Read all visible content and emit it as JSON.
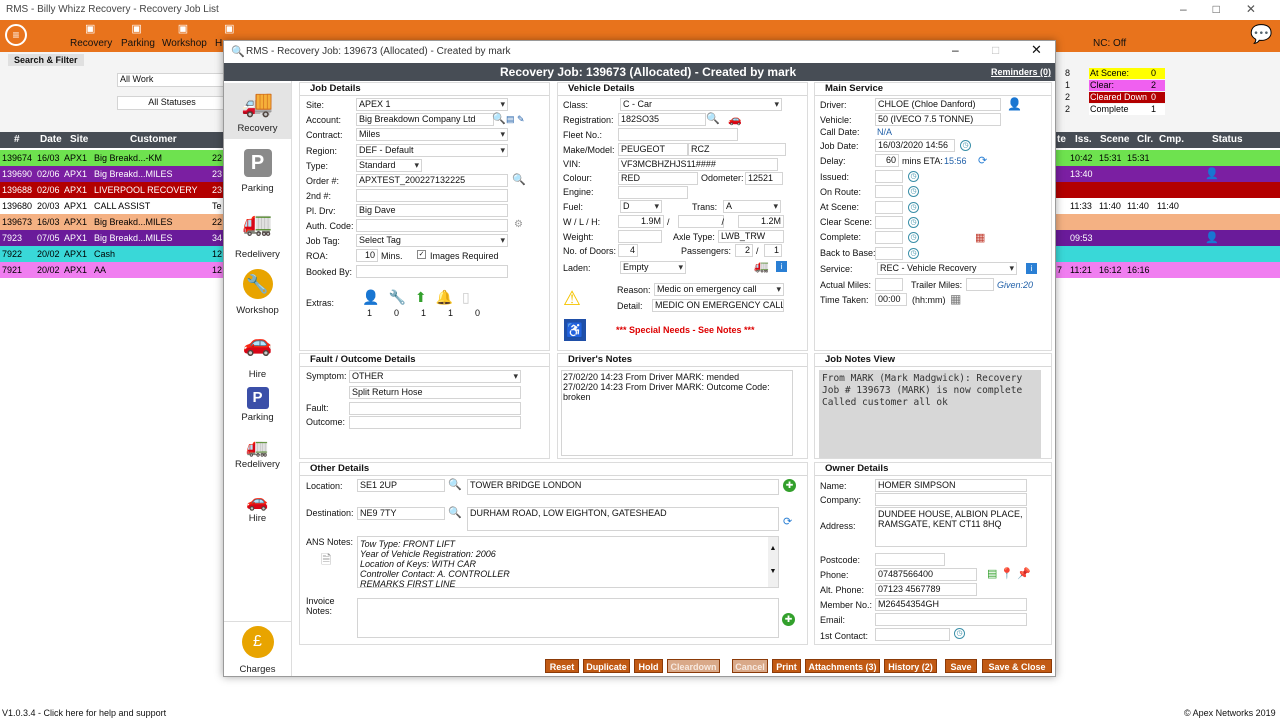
{
  "app": {
    "title": "RMS - Billy Whizz Recovery - Recovery Job List",
    "version": "V1.0.3.4 - Click here for help and support",
    "copyright": "© Apex Networks 2019",
    "nc": "NC: Off"
  },
  "toolbar": [
    "Recovery",
    "Parking",
    "Workshop",
    "H"
  ],
  "filter": {
    "label": "Search & Filter",
    "work": "All Work",
    "statuses": "All Statuses"
  },
  "list": {
    "columns": [
      "#",
      "Date",
      "Site",
      "Customer"
    ],
    "rows": [
      {
        "id": "139674",
        "date": "16/03",
        "site": "APX1",
        "cust": "Big Breakd...-KM",
        "extra": "22",
        "color": "#6ee24f",
        "fg": "#000"
      },
      {
        "id": "139690",
        "date": "02/06",
        "site": "APX1",
        "cust": "Big Breakd...MILES",
        "extra": "23",
        "color": "#7b1fa2",
        "fg": "#fff"
      },
      {
        "id": "139688",
        "date": "02/06",
        "site": "APX1",
        "cust": "LIVERPOOL RECOVERY",
        "extra": "23",
        "color": "#b30000",
        "fg": "#fff"
      },
      {
        "id": "139680",
        "date": "20/03",
        "site": "APX1",
        "cust": "CALL ASSIST",
        "extra": "Te",
        "color": "#ffffff",
        "fg": "#000"
      },
      {
        "id": "139673",
        "date": "16/03",
        "site": "APX1",
        "cust": "Big Breakd...MILES",
        "extra": "22",
        "color": "#f4b183",
        "fg": "#000"
      },
      {
        "id": "7923",
        "date": "07/05",
        "site": "APX1",
        "cust": "Big Breakd...MILES",
        "extra": "34",
        "color": "#6a1b9a",
        "fg": "#fff"
      },
      {
        "id": "7922",
        "date": "20/02",
        "site": "APX1",
        "cust": "Cash",
        "extra": "12",
        "color": "#39d8d8",
        "fg": "#000"
      },
      {
        "id": "7921",
        "date": "20/02",
        "site": "APX1",
        "cust": "AA",
        "extra": "12",
        "color": "#f07ef0",
        "fg": "#000"
      }
    ]
  },
  "right": {
    "legend": [
      {
        "n": "8",
        "label": "At Scene:",
        "v": "0",
        "color": "#ffff00",
        "fg": "#000"
      },
      {
        "n": "1",
        "label": "Clear:",
        "v": "2",
        "color": "#f060f0",
        "fg": "#000"
      },
      {
        "n": "2",
        "label": "Cleared Down",
        "v": "0",
        "color": "#b30000",
        "fg": "#fff"
      },
      {
        "n": "2",
        "label": "Complete",
        "v": "1",
        "color": "#ffffff",
        "fg": "#000"
      }
    ],
    "columns": [
      "te",
      "Iss.",
      "Scene",
      "Clr.",
      "Cmp.",
      "Status"
    ],
    "rows": [
      {
        "c": [
          "",
          "10:42",
          "15:31",
          "15:31",
          ""
        ],
        "color": "#6ee24f",
        "fg": "#000"
      },
      {
        "c": [
          "",
          "13:40",
          "",
          "",
          ""
        ],
        "color": "#7b1fa2",
        "fg": "#fff"
      },
      {
        "c": [
          "",
          "",
          "",
          "",
          ""
        ],
        "color": "#b30000",
        "fg": "#fff"
      },
      {
        "c": [
          "",
          "11:33",
          "11:40",
          "11:40",
          "11:40"
        ],
        "color": "#ffffff",
        "fg": "#000"
      },
      {
        "c": [
          "",
          "",
          "",
          "",
          ""
        ],
        "color": "#f4b183",
        "fg": "#000"
      },
      {
        "c": [
          "",
          "09:53",
          "",
          "",
          ""
        ],
        "color": "#6a1b9a",
        "fg": "#fff"
      },
      {
        "c": [
          "",
          "",
          "",
          "",
          ""
        ],
        "color": "#39d8d8",
        "fg": "#000"
      },
      {
        "c": [
          "7",
          "11:21",
          "16:12",
          "16:16",
          ""
        ],
        "color": "#f07ef0",
        "fg": "#000"
      }
    ]
  },
  "dialog": {
    "window_title": "RMS - Recovery Job: 139673 (Allocated) - Created by mark",
    "banner": "Recovery Job: 139673 (Allocated) - Created by mark",
    "reminders": "Reminders (0)",
    "nav": [
      "Recovery",
      "Parking",
      "Redelivery",
      "Workshop",
      "Hire",
      "Parking",
      "Redelivery",
      "Hire",
      "Charges"
    ]
  },
  "job": {
    "header": "Job Details",
    "site": "APEX 1",
    "account": "Big Breakdown Company Ltd",
    "contract": "Miles",
    "region": "DEF - Default",
    "type": "Standard",
    "order": "APXTEST_200227132225",
    "pl_drv": "Big Dave",
    "job_tag": "Select Tag",
    "roa": "10",
    "roa_unit": "Mins.",
    "images": "Images Required",
    "labels": [
      "Site:",
      "Account:",
      "Contract:",
      "Region:",
      "Type:",
      "Order #:",
      "2nd #:",
      "Pl. Drv:",
      "Auth. Code:",
      "Job Tag:",
      "ROA:",
      "Booked By:",
      "Extras:"
    ],
    "extras": [
      "1",
      "0",
      "1",
      "1",
      "0"
    ]
  },
  "vehicle": {
    "header": "Vehicle Details",
    "class": "C - Car",
    "reg": "182SO35",
    "make": "PEUGEOT",
    "model": "RCZ",
    "vin": "VF3MCBHZHJS11####",
    "colour": "RED",
    "odometer": "12521",
    "fuel": "D",
    "trans": "A",
    "w": "1.9M",
    "h": "1.2M",
    "axle": "LWB_TRW",
    "doors": "4",
    "pass1": "2",
    "pass2": "1",
    "laden": "Empty",
    "reason": "Medic on emergency call",
    "detail": "MEDIC ON EMERGENCY CALL",
    "special": "*** Special Needs - See Notes ***",
    "labels": [
      "Class:",
      "Registration:",
      "Fleet No.:",
      "Make/Model:",
      "VIN:",
      "Colour:",
      "Odometer:",
      "Engine:",
      "Fuel:",
      "Trans:",
      "W / L / H:",
      "Weight:",
      "Axle Type:",
      "No. of Doors:",
      "Passengers:",
      "Laden:",
      "Reason:",
      "Detail:"
    ]
  },
  "service": {
    "header": "Main Service",
    "driver": "CHLOE (Chloe Danford)",
    "vehicle": "50 (IVECO 7.5 TONNE)",
    "call_date": "N/A",
    "job_date": "16/03/2020 14:56",
    "delay": "60",
    "eta_label": "mins ETA:",
    "eta": "15:56",
    "service": "REC - Vehicle Recovery",
    "trailer_label": "Trailer Miles:",
    "given": "Given:20",
    "time_taken": "00:00",
    "time_unit": "(hh:mm)",
    "labels": [
      "Driver:",
      "Vehicle:",
      "Call Date:",
      "Job Date:",
      "Delay:",
      "Issued:",
      "On Route:",
      "At Scene:",
      "Clear Scene:",
      "Complete:",
      "Back to Base:",
      "Service:",
      "Actual Miles:",
      "Time Taken:"
    ]
  },
  "fault": {
    "header": "Fault / Outcome Details",
    "symptom": "OTHER",
    "symptom2": "Split Return Hose",
    "labels": [
      "Symptom:",
      "Fault:",
      "Outcome:"
    ]
  },
  "driver_notes": {
    "header": "Driver's Notes",
    "lines": [
      "27/02/20 14:23 From Driver MARK: mended",
      "27/02/20 14:23 From Driver MARK: Outcome Code:",
      "broken"
    ]
  },
  "job_notes": {
    "header": "Job Notes View",
    "lines": [
      "From MARK (Mark Madgwick): Recovery",
      "Job # 139673 (MARK) is now complete",
      "Called customer all ok"
    ]
  },
  "other": {
    "header": "Other Details",
    "location_pc": "SE1 2UP",
    "location": "TOWER BRIDGE LONDON",
    "dest_pc": "NE9 7TY",
    "destination": "DURHAM ROAD, LOW EIGHTON, GATESHEAD",
    "ans": [
      "Tow Type: FRONT LIFT",
      "Year of Vehicle Registration: 2006",
      "Location of Keys: WITH CAR",
      "Controller Contact: A. CONTROLLER",
      "REMARKS FIRST LINE"
    ],
    "labels": [
      "Location:",
      "Destination:",
      "ANS Notes:",
      "Invoice",
      "Notes:"
    ]
  },
  "owner": {
    "header": "Owner Details",
    "name": "HOMER SIMPSON",
    "address1": "DUNDEE HOUSE, ALBION PLACE,",
    "address2": "RAMSGATE, KENT CT11 8HQ",
    "phone": "07487566400",
    "alt_phone": "07123 4567789",
    "member": "M26454354GH",
    "labels": [
      "Name:",
      "Company:",
      "Address:",
      "Postcode:",
      "Phone:",
      "Alt. Phone:",
      "Member No.:",
      "Email:",
      "1st Contact:"
    ]
  },
  "buttons": [
    "Reset",
    "Duplicate",
    "Hold",
    "Cleardown",
    "Cancel",
    "Print",
    "Attachments (3)",
    "History (2)",
    "Save",
    "Save & Close"
  ]
}
